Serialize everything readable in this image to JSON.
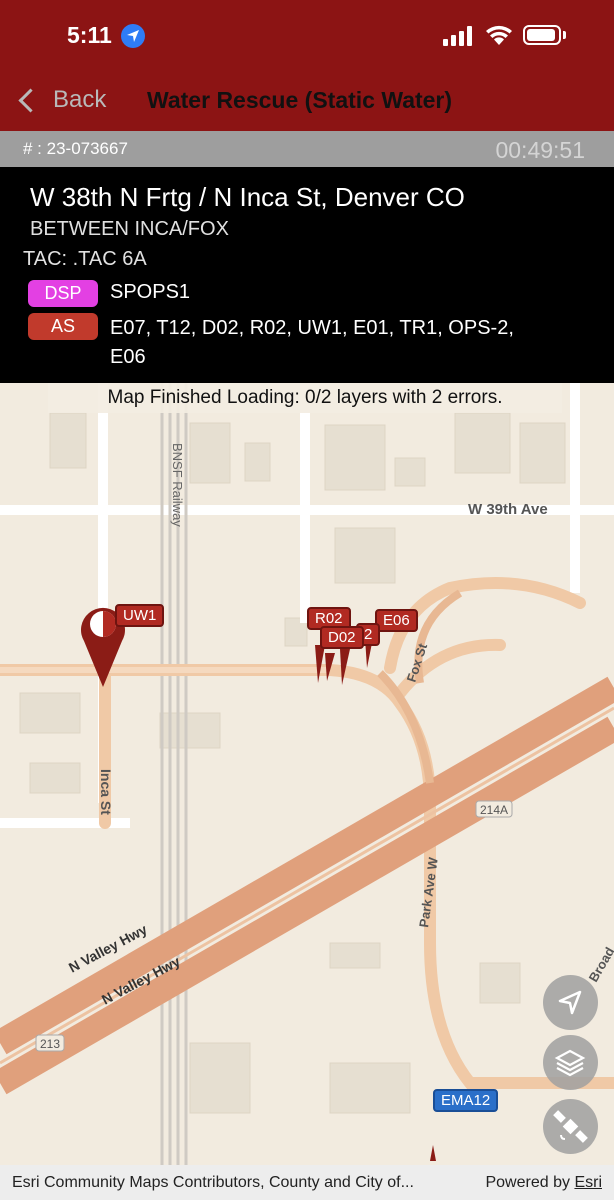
{
  "status": {
    "time": "5:11"
  },
  "nav": {
    "back_label": "Back",
    "title": "Water Rescue (Static Water)"
  },
  "incident": {
    "number_label": "# : 23-073667",
    "elapsed": "00:49:51",
    "address": "W 38th N Frtg / N Inca St, Denver CO",
    "cross_street": "BETWEEN INCA/FOX",
    "tac": "TAC: .TAC 6A",
    "dsp_badge": "DSP",
    "dsp_units": "SPOPS1",
    "as_badge": "AS",
    "as_units": "E07, T12, D02, R02, UW1, E01, TR1, OPS-2, E06"
  },
  "map": {
    "banner": "Map Finished Loading: 0/2 layers with 2 errors.",
    "labels": {
      "w39": "W 39th Ave",
      "bnsf": "BNSF Railway",
      "inca": "Inca St",
      "fox": "Fox St",
      "park": "Park Ave W",
      "valley1": "N Valley Hwy",
      "valley2": "N Valley Hwy",
      "exit214a": "214A",
      "exit213": "213",
      "broad": "Broad"
    },
    "units": {
      "uw1": "UW1",
      "r02": "R02",
      "d02": "D02",
      "e06": "E06",
      "hidden2": "2",
      "ema12": "EMA12"
    },
    "attribution": "Esri Community Maps Contributors, County and City of...",
    "powered_by": "Powered by",
    "esri": "Esri"
  },
  "colors": {
    "header": "#8c1414",
    "dsp": "#e340e3",
    "as": "#c13a2c",
    "unit_pin": "#b12a22",
    "ema_pin": "#2a6fc9"
  }
}
